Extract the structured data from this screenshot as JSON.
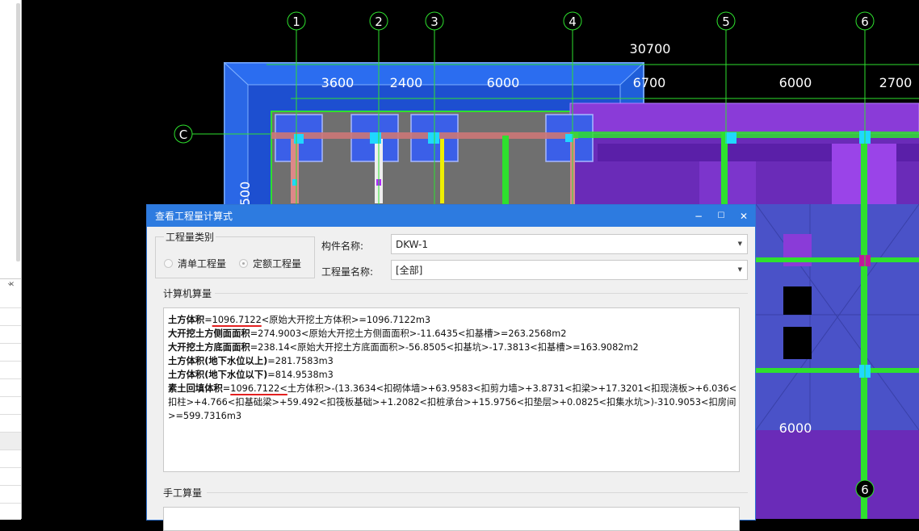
{
  "cad": {
    "axis_labels": [
      "1",
      "2",
      "3",
      "4",
      "5",
      "6",
      "C",
      "6"
    ],
    "dimensions": {
      "total": "30700",
      "spans": [
        "3600",
        "2400",
        "6000",
        "6700",
        "6000",
        "2700"
      ],
      "vertical": "500",
      "bottom": "6000"
    }
  },
  "dialog": {
    "title": "查看工程量计算式",
    "controls": {
      "minimize": "−",
      "maximize": "☐",
      "close": "✕"
    },
    "quantity_type": {
      "legend": "工程量类别",
      "options": [
        "清单工程量",
        "定额工程量"
      ],
      "selected": "定额工程量"
    },
    "component_name": {
      "label": "构件名称:",
      "value": "DKW-1"
    },
    "quantity_name": {
      "label": "工程量名称:",
      "value": "[全部]"
    },
    "computer_section": "计算机算量",
    "lines": [
      {
        "name": "土方体积",
        "eq": "=",
        "underlined": "1096.7122",
        "rest": "<原始大开挖土方体积>=1096.7122m3"
      },
      {
        "name": "大开挖土方侧面面积",
        "eq": "=",
        "underlined": "",
        "rest": "274.9003<原始大开挖土方侧面面积>-11.6435<扣基槽>=263.2568m2"
      },
      {
        "name": "大开挖土方底面面积",
        "eq": "=",
        "underlined": "",
        "rest": "238.14<原始大开挖土方底面面积>-56.8505<扣基坑>-17.3813<扣基槽>=163.9082m2"
      },
      {
        "name": "土方体积(地下水位以上)",
        "eq": "=",
        "underlined": "",
        "rest": "281.7583m3"
      },
      {
        "name": "土方体积(地下水位以下)",
        "eq": "=",
        "underlined": "",
        "rest": "814.9538m3"
      },
      {
        "name": "素土回填体积",
        "eq": "=",
        "underlined": "1096.7122<",
        "rest": "土方体积>-(13.3634<扣砌体墙>+63.9583<扣剪力墙>+3.8731<扣梁>+17.3201<扣现浇板>+6.036<"
      },
      {
        "name": "",
        "eq": "",
        "underlined": "",
        "rest": "扣柱>+4.766<扣基础梁>+59.492<扣筏板基础>+1.2082<扣桩承台>+15.9756<扣垫层>+0.0825<扣集水坑>)-310.9053<扣房间"
      },
      {
        "name": "",
        "eq": "",
        "underlined": "",
        "rest": ">=599.7316m3"
      }
    ],
    "manual_section": "手工算量"
  }
}
